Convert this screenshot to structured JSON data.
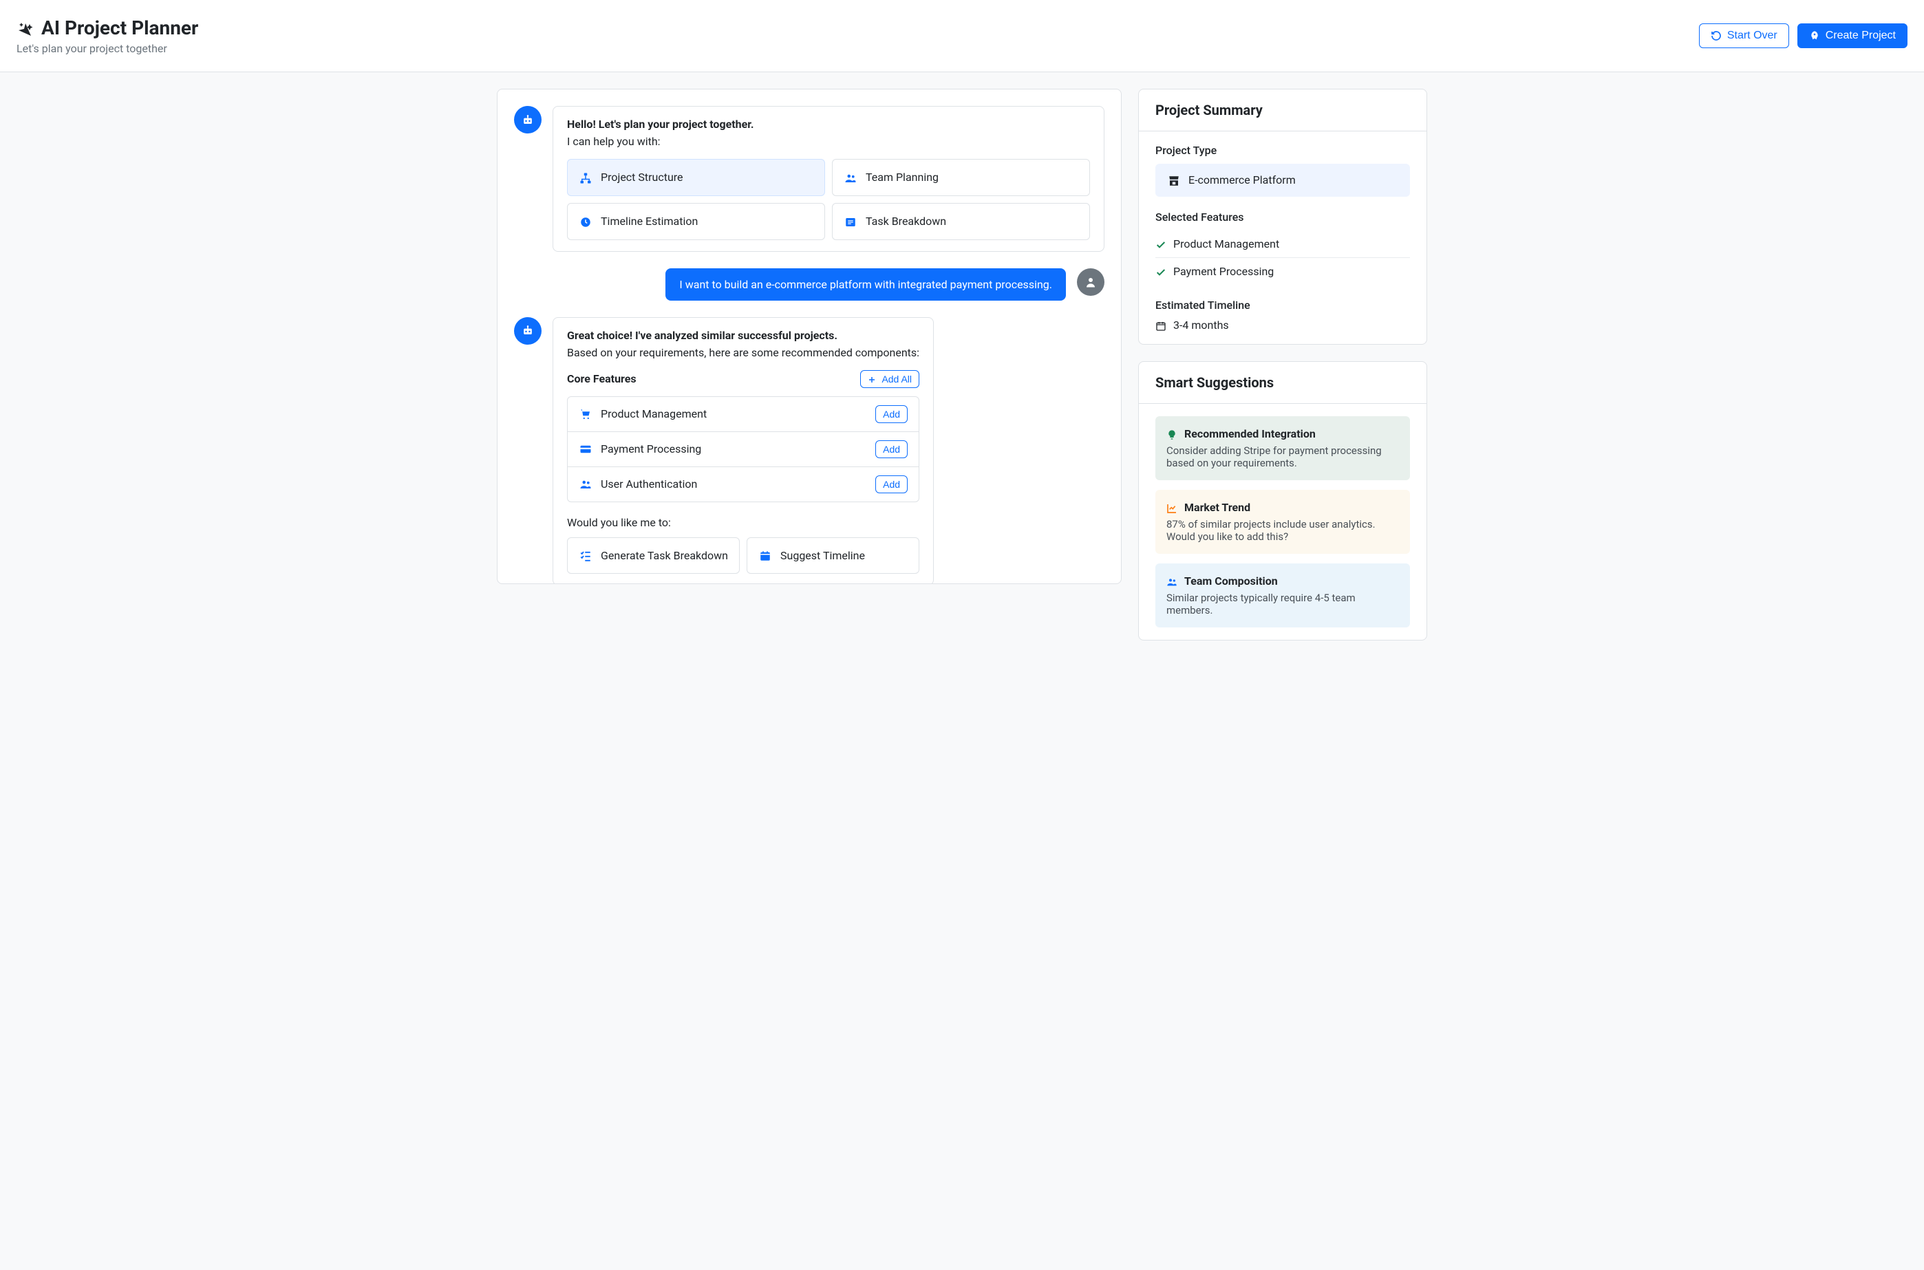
{
  "header": {
    "title": "AI Project Planner",
    "subtitle": "Let's plan your project together",
    "start_over": "Start Over",
    "create_project": "Create Project"
  },
  "chat": {
    "bot_intro": {
      "greeting": "Hello! Let's plan your project together.",
      "help_text": "I can help you with:",
      "options": [
        {
          "label": "Project Structure",
          "active": true
        },
        {
          "label": "Team Planning",
          "active": false
        },
        {
          "label": "Timeline Estimation",
          "active": false
        },
        {
          "label": "Task Breakdown",
          "active": false
        }
      ]
    },
    "user_message": "I want to build an e-commerce platform with integrated payment processing.",
    "bot_analysis": {
      "line1": "Great choice! I've analyzed similar successful projects.",
      "line2": "Based on your requirements, here are some recommended components:",
      "core_features_label": "Core Features",
      "add_all": "Add All",
      "add_label": "Add",
      "features": [
        {
          "label": "Product Management"
        },
        {
          "label": "Payment Processing"
        },
        {
          "label": "User Authentication"
        }
      ],
      "prompt_text": "Would you like me to:",
      "action_options": [
        {
          "label": "Generate Task Breakdown"
        },
        {
          "label": "Suggest Timeline"
        }
      ]
    }
  },
  "summary": {
    "title": "Project Summary",
    "project_type_label": "Project Type",
    "project_type_value": "E-commerce Platform",
    "selected_features_label": "Selected Features",
    "selected_features": [
      "Product Management",
      "Payment Processing"
    ],
    "timeline_label": "Estimated Timeline",
    "timeline_value": "3-4 months"
  },
  "suggestions": {
    "title": "Smart Suggestions",
    "items": [
      {
        "variant": "green",
        "title": "Recommended Integration",
        "body": "Consider adding Stripe for payment processing based on your requirements."
      },
      {
        "variant": "yellow",
        "title": "Market Trend",
        "body": "87% of similar projects include user analytics. Would you like to add this?"
      },
      {
        "variant": "blue",
        "title": "Team Composition",
        "body": "Similar projects typically require 4-5 team members."
      }
    ]
  }
}
